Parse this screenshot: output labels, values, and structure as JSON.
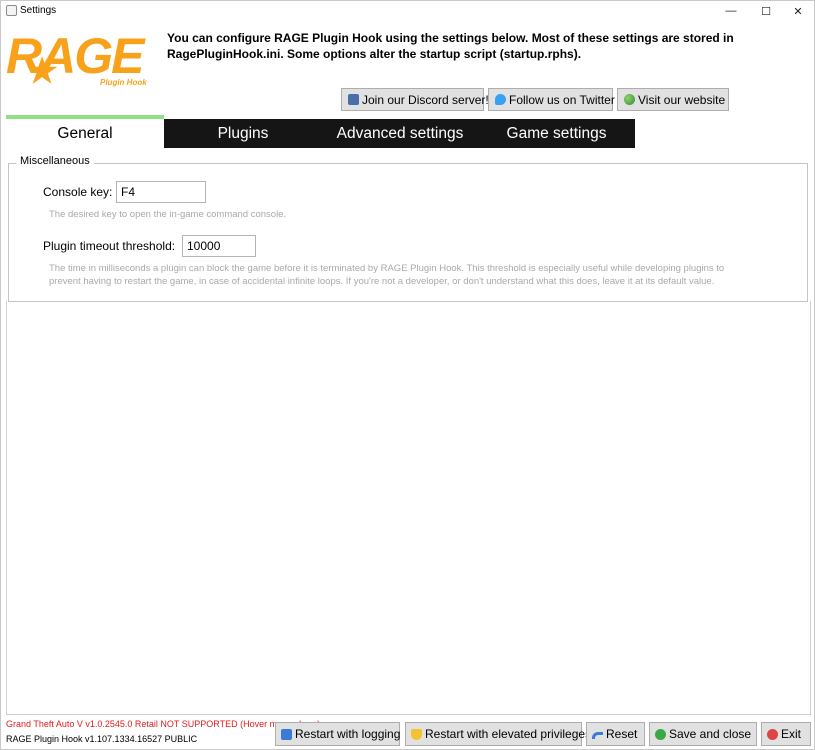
{
  "window": {
    "title": "Settings",
    "minimize_glyph": "—",
    "maximize_glyph": "☐",
    "close_glyph": "✕"
  },
  "header": {
    "logo_text": "RAGE",
    "logo_subtext": "Plugin Hook",
    "intro_line1": "You can configure RAGE Plugin Hook using the settings below. Most of these settings are stored in",
    "intro_line2": "RagePluginHook.ini. Some options alter the startup script (startup.rphs).",
    "links": {
      "discord": "Join our Discord server!",
      "twitter": "Follow us on Twitter",
      "website": "Visit our website"
    }
  },
  "tabs": [
    {
      "label": "General",
      "active": true
    },
    {
      "label": "Plugins",
      "active": false
    },
    {
      "label": "Advanced settings",
      "active": false
    },
    {
      "label": "Game settings",
      "active": false
    }
  ],
  "general": {
    "group_title": "Miscellaneous",
    "console_key": {
      "label": "Console key:",
      "value": "F4",
      "hint": "The desired key to open the in-game command console."
    },
    "plugin_timeout": {
      "label": "Plugin timeout threshold:",
      "value": "10000",
      "hint_line1": "The time in milliseconds a plugin can block the game before it is terminated by RAGE Plugin Hook. This threshold is especially useful while developing plugins to",
      "hint_line2": "prevent having to restart the game, in case of accidental infinite loops. If you're not a developer, or don't understand what this does, leave it at its default value."
    }
  },
  "status": {
    "warning": "Grand Theft Auto V v1.0.2545.0 Retail NOT SUPPORTED (Hover mouse here)",
    "version": "RAGE Plugin Hook v1.107.1334.16527 PUBLIC"
  },
  "actions": {
    "restart_logging": "Restart with logging",
    "restart_elevated": "Restart with elevated privileges",
    "reset": "Reset",
    "save_close": "Save and close",
    "exit": "Exit"
  },
  "colors": {
    "brand_orange": "#f7a21a",
    "tab_accent": "#90e08a",
    "tab_dark": "#151515",
    "warning_red": "#e01b1b"
  }
}
